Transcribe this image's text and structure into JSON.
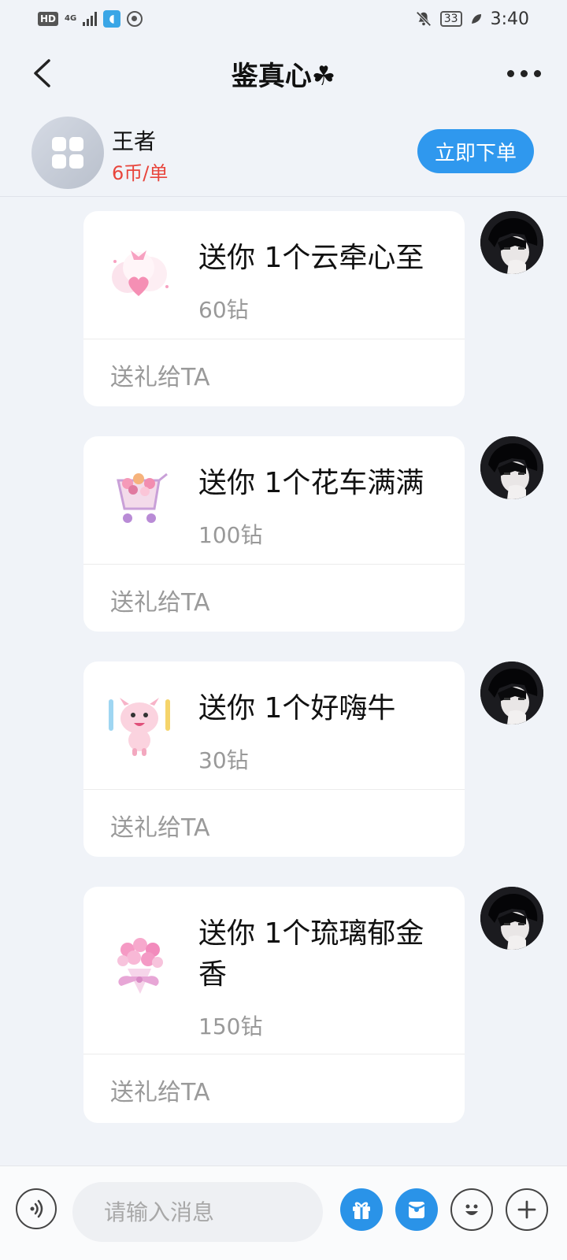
{
  "status_bar": {
    "hd": "HD",
    "network": "4G",
    "battery": "33",
    "time": "3:40"
  },
  "header": {
    "title": "鉴真心☘"
  },
  "service": {
    "name": "王者",
    "price": "6币/单",
    "order_label": "立即下单"
  },
  "messages": [
    {
      "title": "送你 1个云牵心至",
      "price": "60钻",
      "action": "送礼给TA",
      "gift_icon": "cloud-heart-icon"
    },
    {
      "title": "送你 1个花车满满",
      "price": "100钻",
      "action": "送礼给TA",
      "gift_icon": "flower-cart-icon"
    },
    {
      "title": "送你 1个好嗨牛",
      "price": "30钻",
      "action": "送礼给TA",
      "gift_icon": "happy-cow-icon"
    },
    {
      "title": "送你 1个琉璃郁金香",
      "price": "150钻",
      "action": "送礼给TA",
      "gift_icon": "tulip-bouquet-icon"
    }
  ],
  "input_bar": {
    "placeholder": "请输入消息"
  },
  "colors": {
    "accent": "#2f98ee",
    "price_red": "#e8453c",
    "background": "#f0f3f8"
  }
}
